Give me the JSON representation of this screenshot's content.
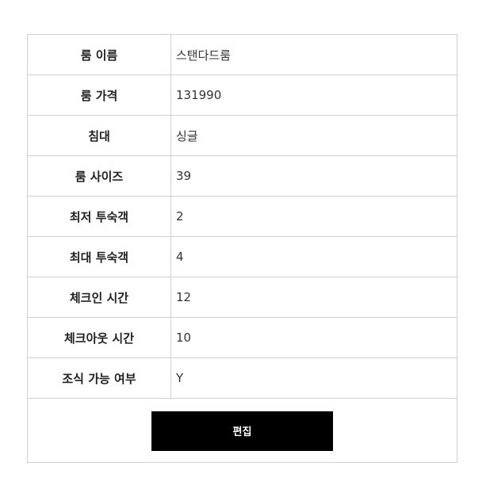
{
  "rows": [
    {
      "label": "룸 이름",
      "value": "스탠다드룸"
    },
    {
      "label": "룸 가격",
      "value": "131990"
    },
    {
      "label": "침대",
      "value": "싱글"
    },
    {
      "label": "룸 사이즈",
      "value": "39"
    },
    {
      "label": "최저 투숙객",
      "value": "2"
    },
    {
      "label": "최대 투숙객",
      "value": "4"
    },
    {
      "label": "체크인 시간",
      "value": "12"
    },
    {
      "label": "체크아웃 시간",
      "value": "10"
    },
    {
      "label": "조식 가능 여부",
      "value": "Y"
    }
  ],
  "actions": {
    "edit_label": "편집"
  }
}
